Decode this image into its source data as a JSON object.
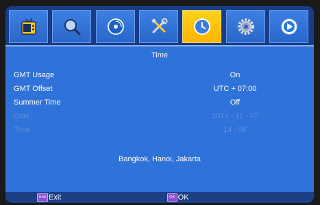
{
  "tabs": [
    {
      "icon": "tv-icon",
      "active": false
    },
    {
      "icon": "search-icon",
      "active": false
    },
    {
      "icon": "disc-icon",
      "active": false
    },
    {
      "icon": "tools-icon",
      "active": false
    },
    {
      "icon": "clock-icon",
      "active": true
    },
    {
      "icon": "gear-icon",
      "active": false
    },
    {
      "icon": "play-icon",
      "active": false
    }
  ],
  "page_title": "Time",
  "settings": [
    {
      "label": "GMT Usage",
      "value": "On",
      "enabled": true
    },
    {
      "label": "GMT Offset",
      "value": "UTC + 07:00",
      "enabled": true
    },
    {
      "label": "Summer Time",
      "value": "Off",
      "enabled": true
    },
    {
      "label": "Date",
      "value": "2012 - 11 - 07",
      "enabled": false
    },
    {
      "label": "Time",
      "value": "14 : 08",
      "enabled": false
    }
  ],
  "region": "Bangkok, Hanoi, Jakarta",
  "footer": {
    "exit_key": "Exit",
    "exit_label": "Exit",
    "ok_key": "OK",
    "ok_label": "OK"
  },
  "colors": {
    "background": "#2f72d9",
    "tabbar": "#173d8a",
    "active_tab": "#ffc20a",
    "disabled_text": "#5c8ee0"
  }
}
